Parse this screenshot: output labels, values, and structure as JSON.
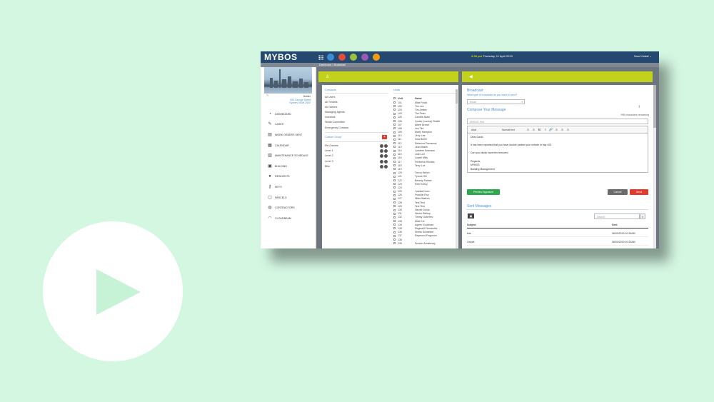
{
  "app": {
    "logo": "MYBOS",
    "datetime_time": "3:38 pm",
    "datetime_date": "Thursday, 11 April 2019",
    "user": "Sam Khalaf ⌄",
    "app_icon_colors": [
      "#3b8fd9",
      "#e24c3c",
      "#9bc23c",
      "#9b59b6",
      "#f39c12"
    ]
  },
  "breadcrumb": "Dashboard > Broadcast",
  "building": {
    "name": "Holder",
    "street": "300 George Street",
    "city": "Sydney NSW 2000"
  },
  "sidebar": {
    "items": [
      {
        "label": "DASHBOARD",
        "icon": "dashboard-icon",
        "glyph": "◔"
      },
      {
        "label": "CASES",
        "icon": "wrench-icon",
        "glyph": "✎"
      },
      {
        "label": "WORK ORDERS SENT",
        "icon": "document-icon",
        "glyph": "▤"
      },
      {
        "label": "CALENDAR",
        "icon": "calendar-icon",
        "glyph": "▦"
      },
      {
        "label": "MAINTENANCE SCHEDULE",
        "icon": "schedule-icon",
        "glyph": "▥"
      },
      {
        "label": "BUILDING",
        "icon": "building-icon",
        "glyph": "▣"
      },
      {
        "label": "RESIDENTS",
        "icon": "residents-icon",
        "glyph": "●"
      },
      {
        "label": "KEYS",
        "icon": "key-icon",
        "glyph": "⚷"
      },
      {
        "label": "PARCELS",
        "icon": "parcel-icon",
        "glyph": "▢"
      },
      {
        "label": "CONTRACTORS",
        "icon": "contractors-icon",
        "glyph": "◍"
      },
      {
        "label": "CLOUDBEAM",
        "icon": "wifi-icon",
        "glyph": "◠"
      }
    ]
  },
  "contacts": {
    "title": "Contacts",
    "items": [
      "All Users",
      "All Tenants",
      "All Owners",
      "Managing Agents",
      "Investors",
      "Strata Committee",
      "Emergency Contacts"
    ],
    "custom_group_label": "Custom Group",
    "add_label": "+",
    "groups": [
      "Pet Owners",
      "Level 1",
      "Level 2",
      "Level 3",
      "Bike"
    ]
  },
  "units": {
    "title": "Units",
    "col_unit": "Unit",
    "col_name": "Name",
    "rows": [
      [
        "101",
        "Mike Frank"
      ],
      [
        "102",
        "Tim Lee"
      ],
      [
        "103",
        "Tim Amber"
      ],
      [
        "104",
        "Tim Peter"
      ],
      [
        "105",
        "Camille Allam"
      ],
      [
        "106",
        "Louise (Louisa) Chaftri"
      ],
      [
        "107",
        "Albert Brown"
      ],
      [
        "108",
        "Lee Tim"
      ],
      [
        "109",
        "Marty Hampton"
      ],
      [
        "110",
        "Jerry Lee"
      ],
      [
        "111",
        "Irma Butler"
      ],
      [
        "112",
        "Rebecca Townsend"
      ],
      [
        "113",
        "Jean Martin"
      ],
      [
        "114",
        "Lorraine Swanson"
      ],
      [
        "115",
        "Josh Lee"
      ],
      [
        "116",
        "Lowell Mills"
      ],
      [
        "117",
        "Frederick Rhodes"
      ],
      [
        "118",
        "Terry Lux"
      ],
      [
        "119",
        ""
      ],
      [
        "120",
        "Trevor Welch"
      ],
      [
        "121",
        "Tyrone Hill"
      ],
      [
        "122",
        "Beverly Palmer"
      ],
      [
        "123",
        "Pete Kelley"
      ],
      [
        "124",
        ""
      ],
      [
        "125",
        "Juanita Dunn"
      ],
      [
        "126",
        "Franklin Roy"
      ],
      [
        "127",
        "Hilda Watson"
      ],
      [
        "128",
        "Test Test"
      ],
      [
        "129",
        "Test Test"
      ],
      [
        "130",
        "Harold Junior"
      ],
      [
        "131",
        "Hector Bishop"
      ],
      [
        "132",
        "Timmy Gutierrez"
      ],
      [
        "133",
        "Mike Kel"
      ],
      [
        "134",
        "Agnes Goodman"
      ],
      [
        "135",
        "Reginald Fernandez"
      ],
      [
        "136",
        "Sheila Schneider"
      ],
      [
        "137",
        "Raymond Ferguson"
      ],
      [
        "138",
        ""
      ],
      [
        "139",
        "Doreen Armstrong"
      ]
    ]
  },
  "broadcast": {
    "title": "Broadcast",
    "question": "What type of broadcast do you want to send?",
    "type_value": "Email",
    "compose_title": "Compose Your Message",
    "remaining": "999 characters remaining",
    "subject_value": "MYBOS Test",
    "font_value": "Arial",
    "size_value": "Normal text",
    "toolbar": [
      "≡",
      "≡",
      "B",
      "I",
      "🔗",
      "≡",
      "≡",
      "≡"
    ],
    "message_lines": [
      "Dear David,",
      "",
      "It has been reported that you have double parked your vehicle in bay 402.",
      "",
      "Can you kindly have this removed.",
      "",
      "Regards,",
      "MYBOS",
      "Building Management"
    ],
    "preview_label": "Preview Signature",
    "cancel_label": "Cancel",
    "send_label": "Send",
    "sent_title": "Sent Messages",
    "search_placeholder": "Search",
    "col_subject": "Subject",
    "col_sent": "Sent",
    "sent_rows": [
      {
        "subject": "test",
        "sent": "06/03/2019 10:30AM"
      },
      {
        "subject": "Carpet",
        "sent": "06/03/2019 10:20AM"
      }
    ]
  }
}
